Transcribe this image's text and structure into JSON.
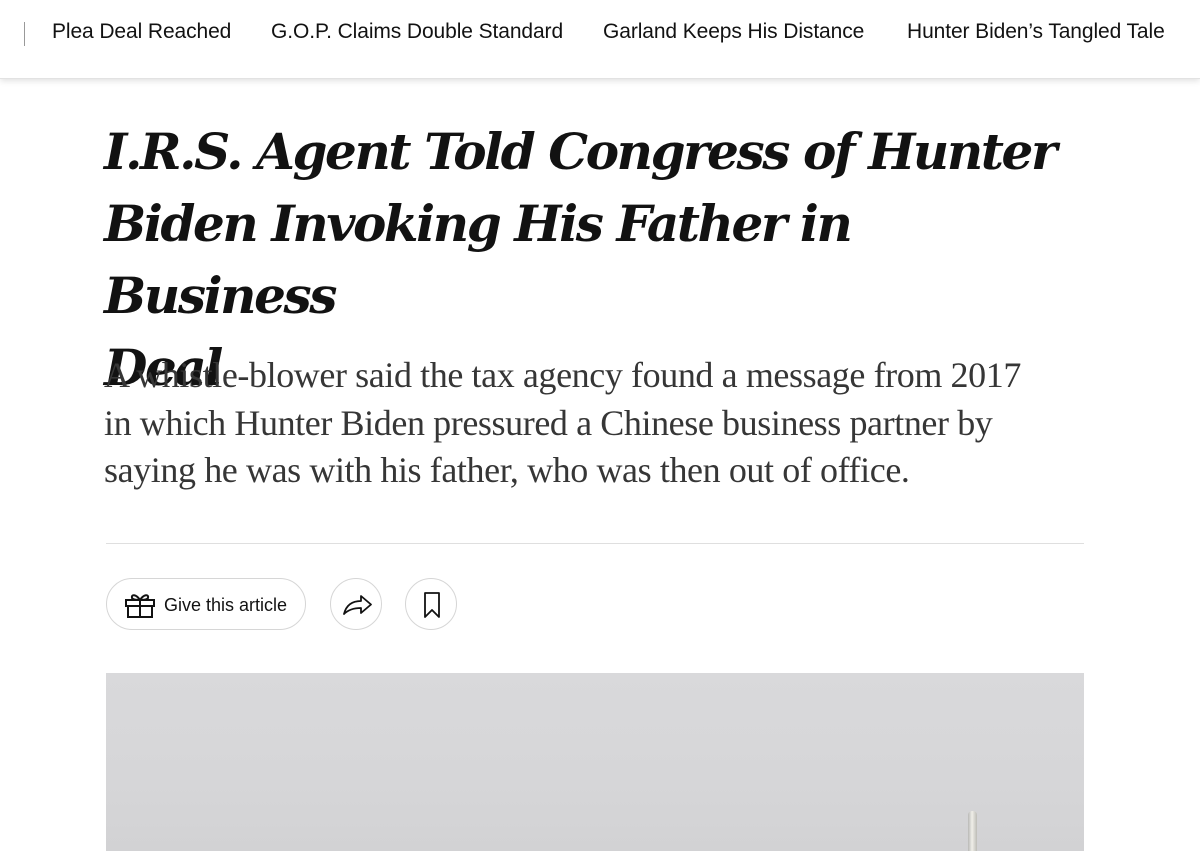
{
  "topnav": {
    "items": [
      {
        "label": "Plea Deal Reached"
      },
      {
        "label": "G.O.P. Claims Double Standard"
      },
      {
        "label": "Garland Keeps His Distance"
      },
      {
        "label": "Hunter Biden’s Tangled Tale"
      }
    ]
  },
  "article": {
    "headline_lines": [
      "I.R.S. Agent Told Congress of Hunter",
      "Biden Invoking His Father in Business",
      "Deal"
    ],
    "summary_lines": [
      "A whistle-blower said the tax agency found a message from 2017",
      "in which Hunter Biden pressured a Chinese business partner by",
      "saying he was with his father, who was then out of office."
    ]
  },
  "actions": {
    "gift_label": "Give this article",
    "icons": {
      "gift": "gift-icon",
      "share": "share-arrow-icon",
      "save": "bookmark-icon"
    }
  },
  "colors": {
    "text": "#121212",
    "summary_text": "#363636",
    "button_border": "#d6d6d6",
    "rule": "#dfdfdf",
    "image_bg": "#d7d7d9"
  }
}
